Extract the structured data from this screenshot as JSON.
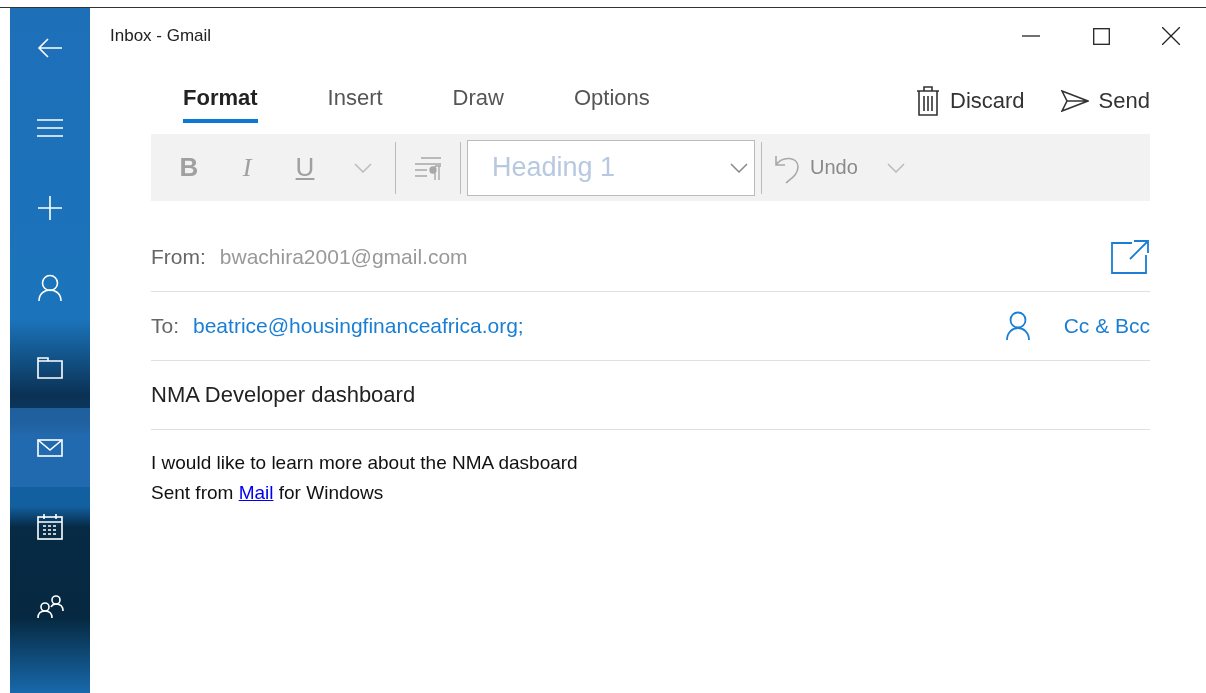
{
  "window": {
    "title": "Inbox - Gmail"
  },
  "sidebar": {
    "items": [
      {
        "kind": "back",
        "selected": false
      },
      {
        "kind": "menu",
        "selected": false
      },
      {
        "kind": "new",
        "selected": false
      },
      {
        "kind": "account",
        "selected": false
      },
      {
        "kind": "folders",
        "selected": false
      },
      {
        "kind": "mail",
        "selected": true
      },
      {
        "kind": "calendar",
        "selected": false
      },
      {
        "kind": "people",
        "selected": false
      }
    ]
  },
  "tabs": [
    {
      "label": "Format",
      "selected": true
    },
    {
      "label": "Insert",
      "selected": false
    },
    {
      "label": "Draw",
      "selected": false
    },
    {
      "label": "Options",
      "selected": false
    }
  ],
  "actions": [
    {
      "kind": "discard",
      "label": "Discard"
    },
    {
      "kind": "send",
      "label": "Send"
    }
  ],
  "toolbar": {
    "disabled": true,
    "bold": "B",
    "italic": "I",
    "underline": "U",
    "style": "Heading 1",
    "undo": "Undo"
  },
  "from": {
    "label": "From:",
    "value": "bwachira2001@gmail.com"
  },
  "to": {
    "label": "To:",
    "value": "beatrice@housingfinanceafrica.org;",
    "cc": "Cc & Bcc"
  },
  "subject": "NMA Developer dashboard",
  "body": {
    "lines": [
      "I would like to learn more about the NMA dasboard"
    ],
    "signature": {
      "before": "Sent from ",
      "link": "Mail",
      "after": " for Windows"
    }
  }
}
